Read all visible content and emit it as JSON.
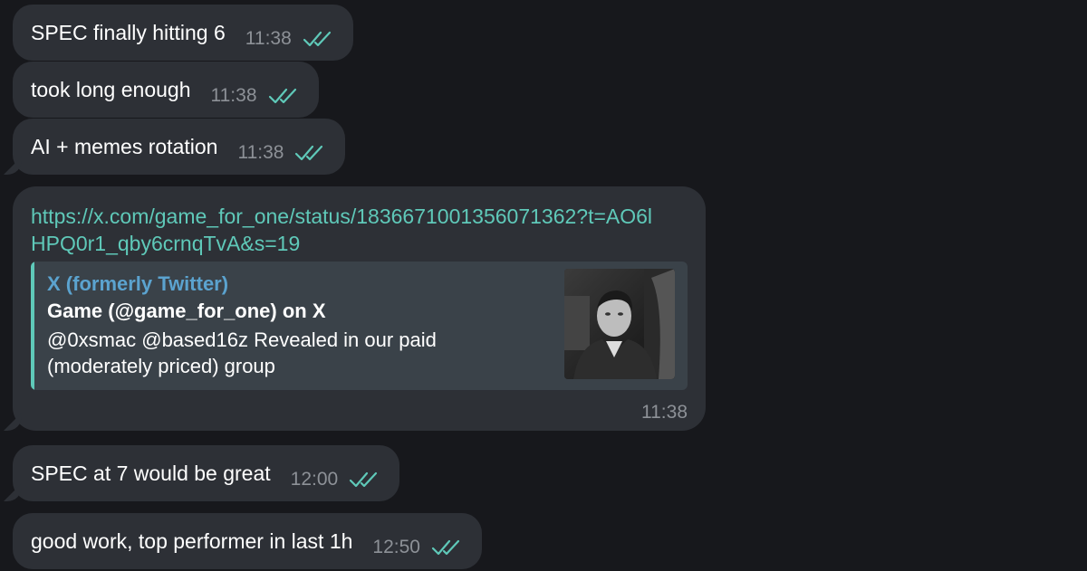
{
  "colors": {
    "background": "#17181c",
    "bubble": "#2d3036",
    "link": "#5fc9b9",
    "preview_site": "#5ba3cf",
    "time": "#8d9197",
    "check": "#5fc9b9"
  },
  "messages": [
    {
      "text": "SPEC finally hitting 6",
      "time": "11:38",
      "status_icon": "double-check-icon"
    },
    {
      "text": "took long enough",
      "time": "11:38",
      "status_icon": "double-check-icon"
    },
    {
      "text": "AI + memes rotation",
      "time": "11:38",
      "status_icon": "double-check-icon"
    },
    {
      "text": "SPEC at 7 would be great",
      "time": "12:00",
      "status_icon": "double-check-icon"
    },
    {
      "text": "good work, top performer in last 1h",
      "time": "12:50",
      "status_icon": "double-check-icon"
    }
  ],
  "link_message": {
    "url": "https://x.com/game_for_one/status/1836671001356071362?t=AO6lHPQ0r1_qby6crnqTvA&s=19",
    "time": "11:38",
    "preview": {
      "site": "X (formerly Twitter)",
      "title": "Game (@game_for_one) on X",
      "description": "@0xsmac @based16z Revealed in our paid (moderately priced) group",
      "thumbnail": "black-and-white-portrait-photo"
    }
  }
}
